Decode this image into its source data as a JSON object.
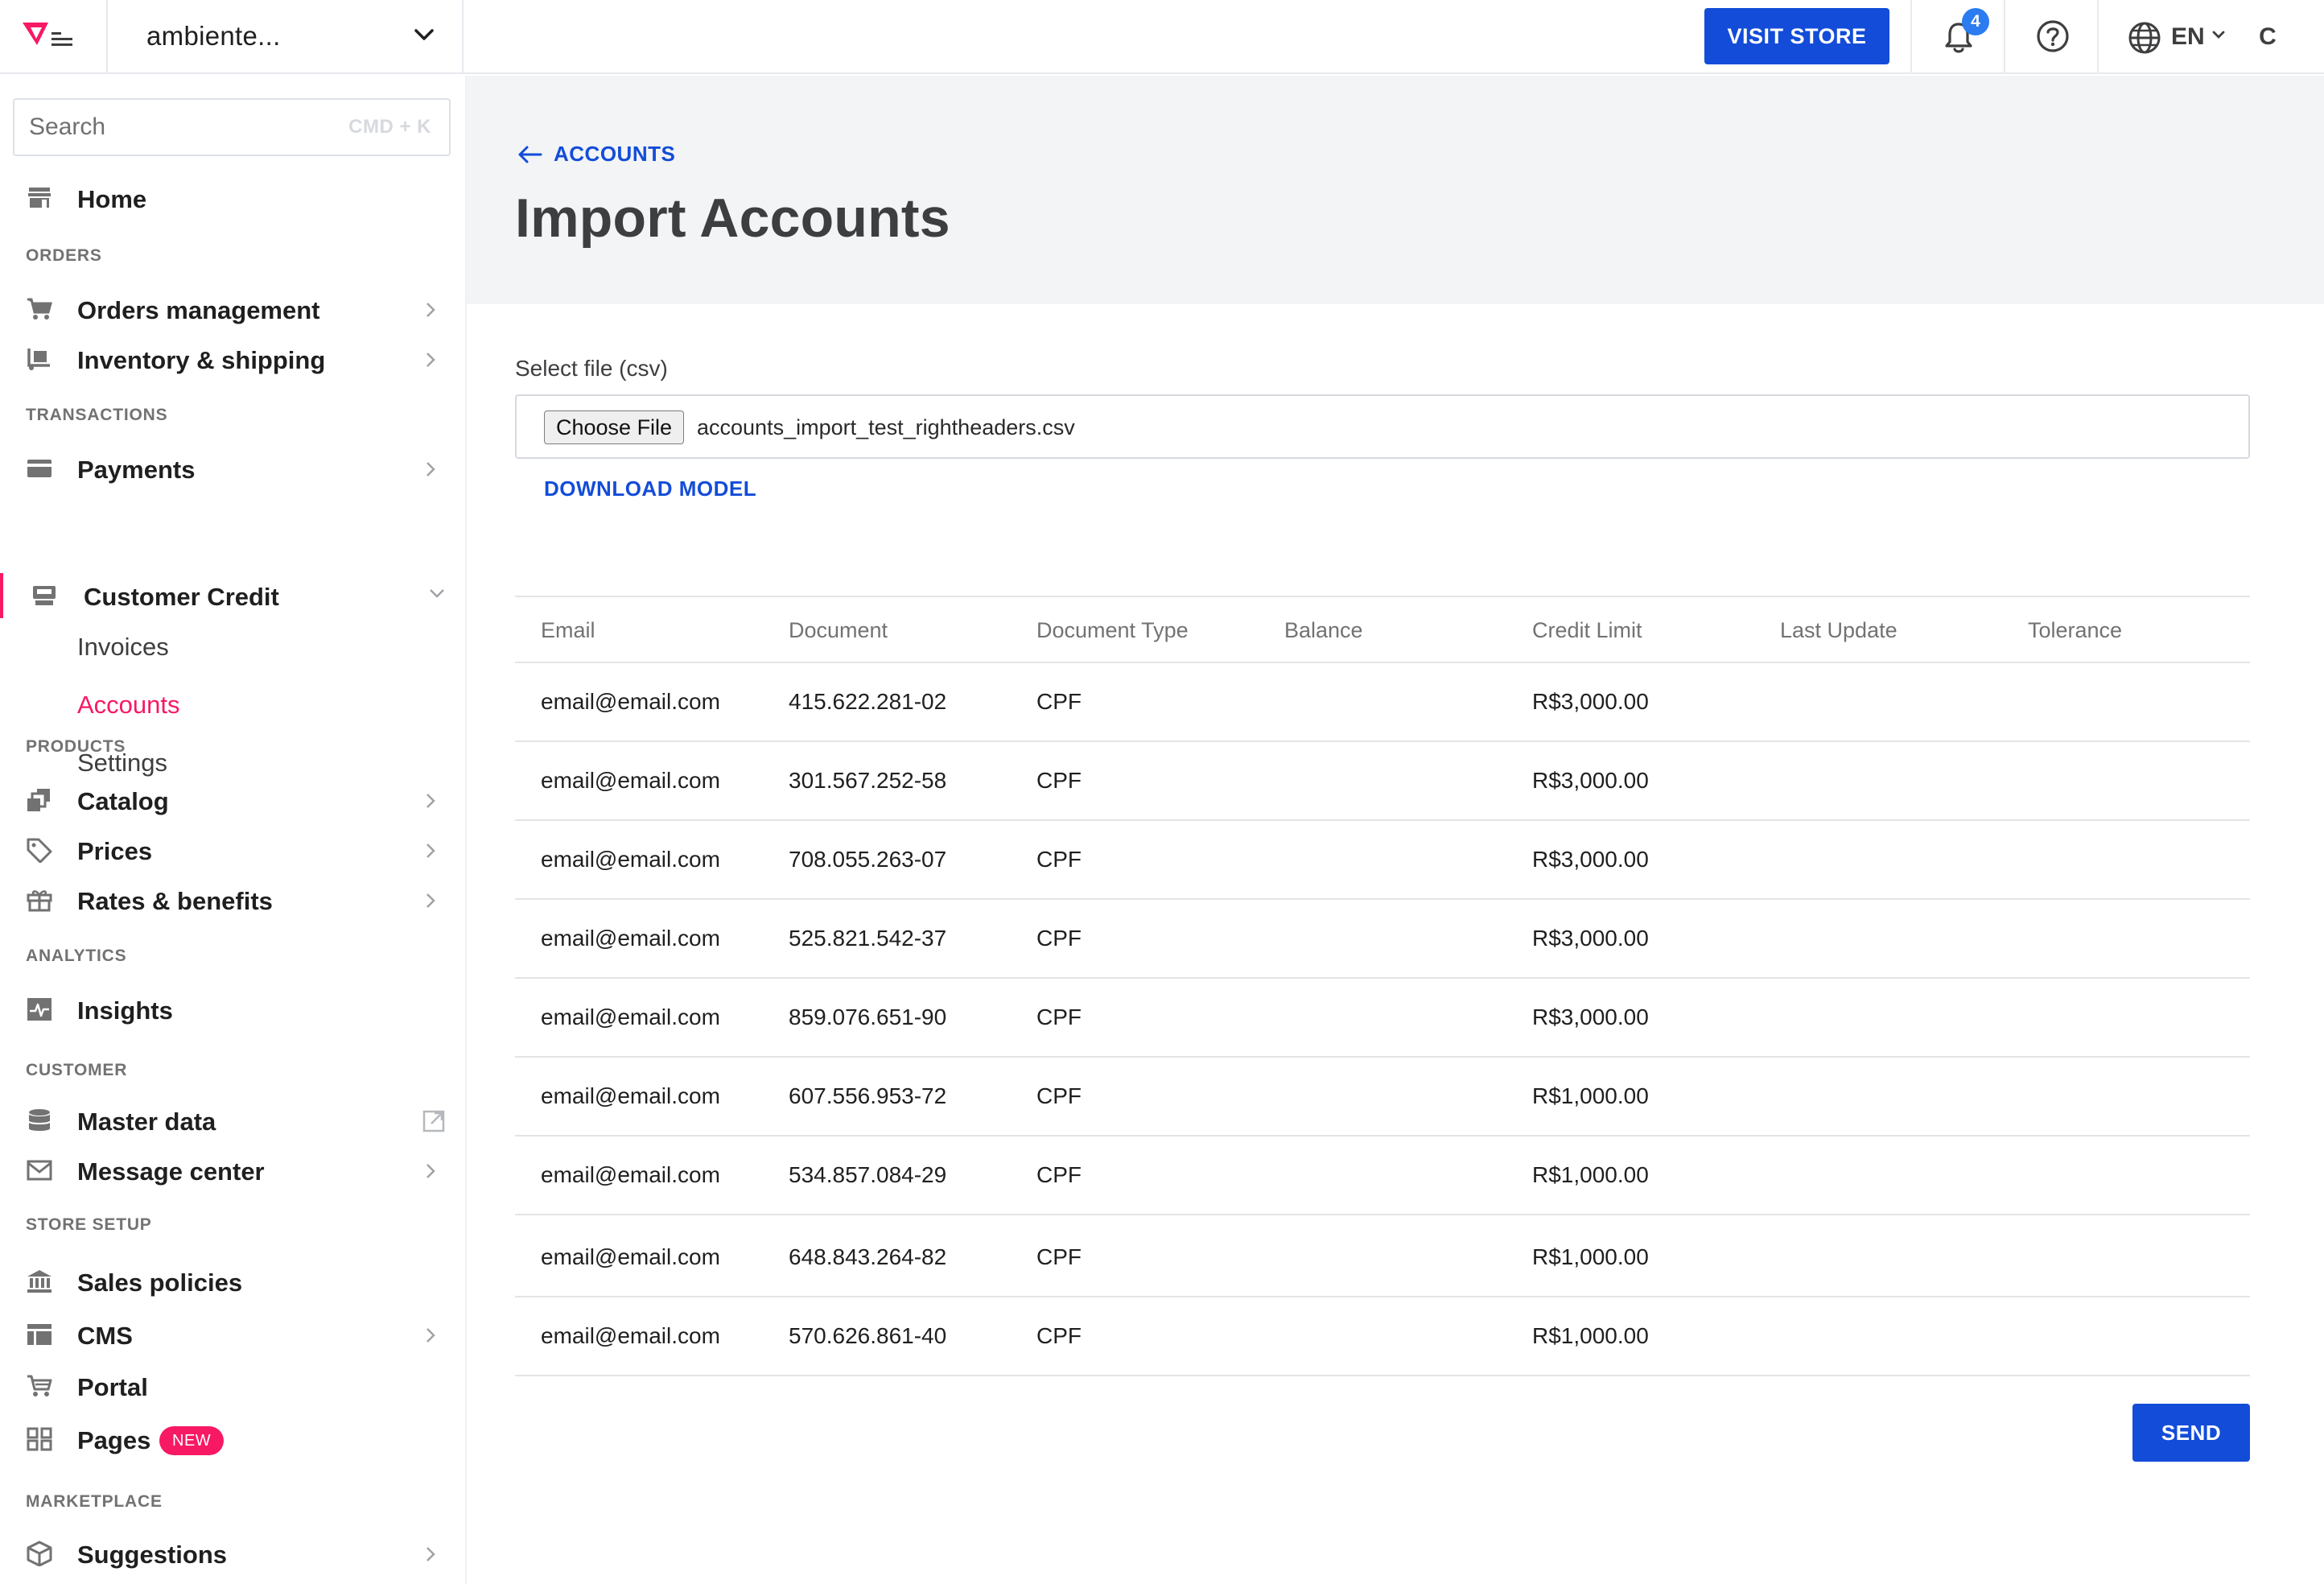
{
  "topbar": {
    "account_name": "ambiente...",
    "visit_store_label": "VISIT STORE",
    "notification_count": "4",
    "language": "EN",
    "user_initial": "C"
  },
  "sidebar": {
    "search_placeholder": "Search",
    "search_shortcut": "CMD + K",
    "home": "Home",
    "sections": {
      "orders": "ORDERS",
      "transactions": "TRANSACTIONS",
      "products": "PRODUCTS",
      "analytics": "ANALYTICS",
      "customer": "CUSTOMER",
      "store_setup": "STORE SETUP",
      "marketplace": "MARKETPLACE"
    },
    "items": {
      "orders_management": "Orders management",
      "inventory_shipping": "Inventory & shipping",
      "payments": "Payments",
      "customer_credit": "Customer Credit",
      "invoices": "Invoices",
      "accounts": "Accounts",
      "settings": "Settings",
      "catalog": "Catalog",
      "prices": "Prices",
      "rates_benefits": "Rates & benefits",
      "insights": "Insights",
      "master_data": "Master data",
      "message_center": "Message center",
      "sales_policies": "Sales policies",
      "cms": "CMS",
      "portal": "Portal",
      "pages": "Pages",
      "pages_badge": "NEW",
      "suggestions": "Suggestions"
    }
  },
  "main": {
    "breadcrumb": "ACCOUNTS",
    "title": "Import Accounts",
    "file_label": "Select file (csv)",
    "choose_file_label": "Choose File",
    "file_name": "accounts_import_test_rightheaders.csv",
    "download_model": "DOWNLOAD MODEL",
    "send_label": "SEND"
  },
  "table": {
    "columns": [
      "Email",
      "Document",
      "Document Type",
      "Balance",
      "Credit Limit",
      "Last Update",
      "Tolerance"
    ],
    "rows": [
      {
        "email": "email@email.com",
        "document": "415.622.281-02",
        "type": "CPF",
        "balance": "",
        "credit_limit": "R$3,000.00",
        "last_update": "",
        "tolerance": ""
      },
      {
        "email": "email@email.com",
        "document": "301.567.252-58",
        "type": "CPF",
        "balance": "",
        "credit_limit": "R$3,000.00",
        "last_update": "",
        "tolerance": ""
      },
      {
        "email": "email@email.com",
        "document": "708.055.263-07",
        "type": "CPF",
        "balance": "",
        "credit_limit": "R$3,000.00",
        "last_update": "",
        "tolerance": ""
      },
      {
        "email": "email@email.com",
        "document": "525.821.542-37",
        "type": "CPF",
        "balance": "",
        "credit_limit": "R$3,000.00",
        "last_update": "",
        "tolerance": ""
      },
      {
        "email": "email@email.com",
        "document": "859.076.651-90",
        "type": "CPF",
        "balance": "",
        "credit_limit": "R$3,000.00",
        "last_update": "",
        "tolerance": ""
      },
      {
        "email": "email@email.com",
        "document": "607.556.953-72",
        "type": "CPF",
        "balance": "",
        "credit_limit": "R$1,000.00",
        "last_update": "",
        "tolerance": ""
      },
      {
        "email": "email@email.com",
        "document": "534.857.084-29",
        "type": "CPF",
        "balance": "",
        "credit_limit": "R$1,000.00",
        "last_update": "",
        "tolerance": ""
      },
      {
        "email": "email@email.com",
        "document": "648.843.264-82",
        "type": "CPF",
        "balance": "",
        "credit_limit": "R$1,000.00",
        "last_update": "",
        "tolerance": ""
      },
      {
        "email": "email@email.com",
        "document": "570.626.861-40",
        "type": "CPF",
        "balance": "",
        "credit_limit": "R$1,000.00",
        "last_update": "",
        "tolerance": ""
      }
    ]
  },
  "colors": {
    "primary": "#134cd8",
    "accent": "#f71963",
    "header_bg": "#f2f4f5"
  },
  "icons": {
    "logo": "vtex-logo-icon",
    "bell": "bell-icon",
    "help": "help-icon",
    "globe": "globe-icon"
  }
}
